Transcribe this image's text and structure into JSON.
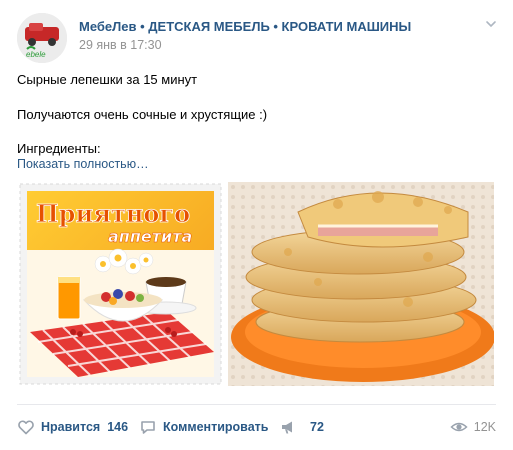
{
  "post": {
    "author": "МебеЛев • ДЕТСКАЯ МЕБЕЛЬ • КРОВАТИ МАШИНЫ",
    "date": "29 янв в 17:30",
    "avatar_text": "ebele",
    "text_lines": [
      "Сырные лепешки за 15 минут",
      "Получаются очень сочные и хрустящие :)",
      "Ингредиенты:"
    ],
    "show_more": "Показать полностью…",
    "images": [
      {
        "icon": "greeting-card-image",
        "title": "Приятного",
        "subtitle": "аппетита"
      },
      {
        "icon": "cheese-flatbread-photo"
      }
    ]
  },
  "actions": {
    "like_label": "Нравится",
    "like_count": "146",
    "comment_label": "Комментировать",
    "share_count": "72",
    "views": "12K"
  },
  "colors": {
    "link": "#2a5885",
    "muted": "#939393",
    "icon": "#99a2ad",
    "divider": "#e7e8ec"
  }
}
